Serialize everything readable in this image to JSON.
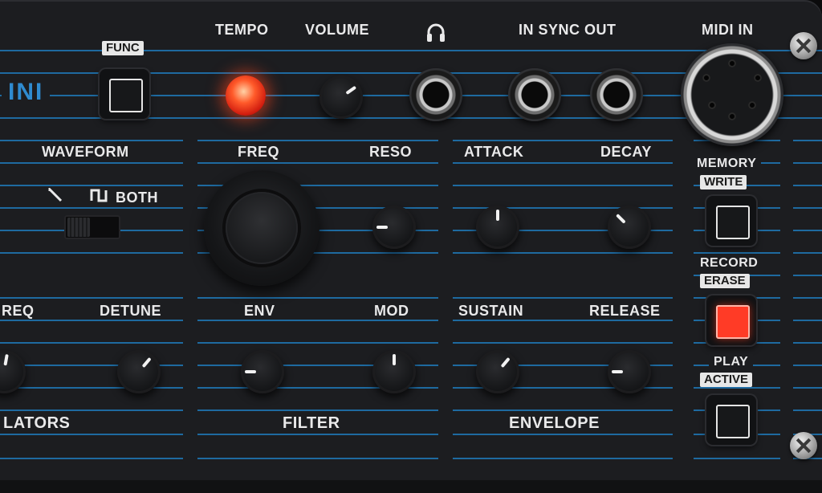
{
  "brand": {
    "text": "INI"
  },
  "top": {
    "func_tag": "FUNC",
    "tempo": "TEMPO",
    "volume": "VOLUME",
    "headphones_icon": "headphones-icon",
    "sync": "IN SYNC OUT",
    "midi": "MIDI IN"
  },
  "osc": {
    "waveform": "WAVEFORM",
    "wave_saw_icon": "saw-wave-icon",
    "wave_square_icon": "square-wave-icon",
    "both": "BOTH",
    "freq": "REQ",
    "detune": "DETUNE",
    "section": "LATORS"
  },
  "filter": {
    "freq": "FREQ",
    "reso": "RESO",
    "env": "ENV",
    "mod": "MOD",
    "section": "FILTER"
  },
  "envelope": {
    "attack": "ATTACK",
    "decay": "DECAY",
    "sustain": "SUSTAIN",
    "release": "RELEASE",
    "section": "ENVELOPE"
  },
  "side": {
    "memory": "MEMORY",
    "write": "WRITE",
    "record": "RECORD",
    "erase": "ERASE",
    "play": "PLAY",
    "active": "ACTIVE"
  },
  "colors": {
    "panel": "#1c1d20",
    "stripe": "#1f6fa8",
    "led": "#ff3b26",
    "brand": "#2f8bd0"
  }
}
